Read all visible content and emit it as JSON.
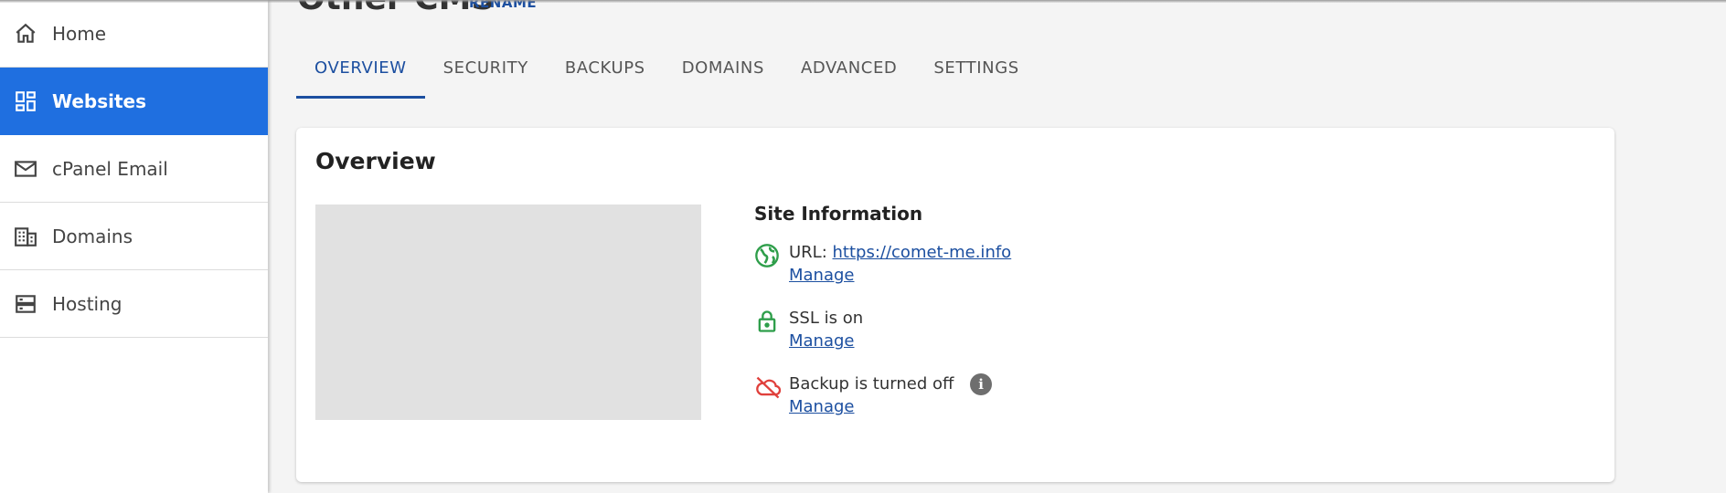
{
  "sidebar": {
    "items": [
      {
        "label": "Home",
        "icon": "home-icon"
      },
      {
        "label": "Websites",
        "icon": "dashboard-icon",
        "active": true
      },
      {
        "label": "cPanel Email",
        "icon": "mail-icon"
      },
      {
        "label": "Domains",
        "icon": "building-icon"
      },
      {
        "label": "Hosting",
        "icon": "server-icon"
      }
    ],
    "active_color": "#1f6fe0"
  },
  "header": {
    "title": "Other CMS",
    "rename_label": "RENAME"
  },
  "tabs": [
    {
      "label": "OVERVIEW",
      "active": true
    },
    {
      "label": "SECURITY"
    },
    {
      "label": "BACKUPS"
    },
    {
      "label": "DOMAINS"
    },
    {
      "label": "ADVANCED"
    },
    {
      "label": "SETTINGS"
    }
  ],
  "overview": {
    "title": "Overview",
    "site_info": {
      "title": "Site Information",
      "url_label": "URL:",
      "url": "https://comet-me.info",
      "url_manage": "Manage",
      "ssl_text": "SSL is on",
      "ssl_manage": "Manage",
      "backup_text": "Backup is turned off",
      "backup_manage": "Manage",
      "info_glyph": "i"
    }
  },
  "colors": {
    "accent": "#1c4fa0",
    "success": "#2e9e4a",
    "danger": "#e0403c"
  }
}
